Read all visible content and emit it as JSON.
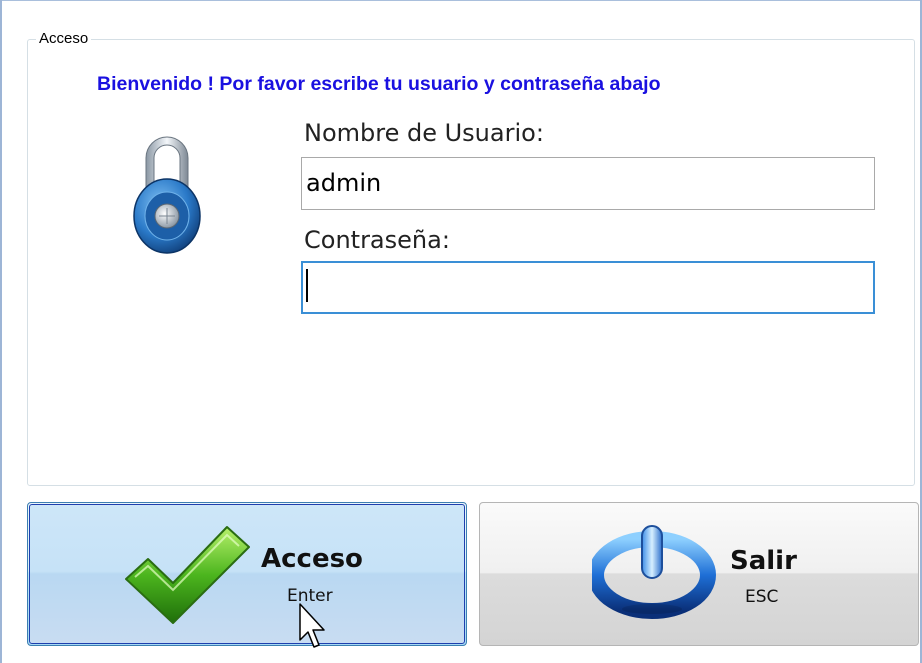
{
  "group": {
    "legend": "Acceso"
  },
  "welcome_text": "Bienvenido ! Por favor escribe tu usuario y contraseña abajo",
  "username": {
    "label": "Nombre de Usuario:",
    "value": "admin"
  },
  "password": {
    "label": "Contraseña:",
    "value": ""
  },
  "buttons": {
    "login": {
      "title": "Acceso",
      "shortcut": "Enter"
    },
    "exit": {
      "title": "Salir",
      "shortcut": "ESC"
    }
  },
  "colors": {
    "welcome": "#1a10e0",
    "focus_border": "#3a8fd6",
    "login_border": "#1f3fae"
  },
  "icons": {
    "lock": "padlock-icon",
    "login": "checkmark-icon",
    "exit": "power-icon"
  }
}
